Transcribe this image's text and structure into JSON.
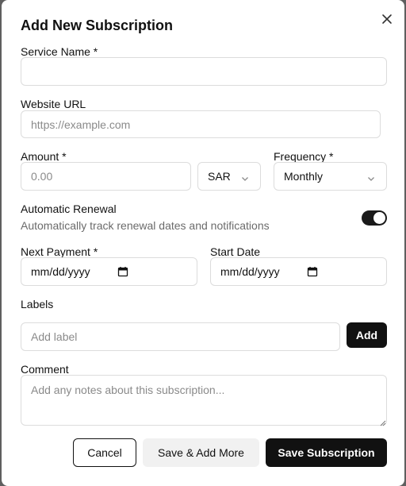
{
  "dialog": {
    "title": "Add New Subscription"
  },
  "form": {
    "service_name": {
      "label": "Service Name *",
      "value": "",
      "placeholder": ""
    },
    "website_url": {
      "label": "Website URL",
      "value": "",
      "placeholder": "https://example.com"
    },
    "amount": {
      "label": "Amount *",
      "value": "",
      "placeholder": "0.00"
    },
    "currency": {
      "value": "SAR"
    },
    "frequency": {
      "label": "Frequency *",
      "value": "Monthly"
    },
    "automatic_renewal": {
      "label": "Automatic Renewal",
      "description": "Automatically track renewal dates and notifications",
      "enabled": true
    },
    "next_payment": {
      "label": "Next Payment *",
      "placeholder": "mm/dd/yyyy"
    },
    "start_date": {
      "label": "Start Date",
      "placeholder": "mm/dd/yyyy"
    },
    "labels": {
      "label": "Labels",
      "placeholder": "Add label",
      "add_button": "Add"
    },
    "comment": {
      "label": "Comment",
      "placeholder": "Add any notes about this subscription..."
    }
  },
  "actions": {
    "cancel": "Cancel",
    "save_add_more": "Save & Add More",
    "save": "Save Subscription"
  },
  "colors": {
    "primary": "#111111",
    "border": "#dcdcdc",
    "muted_text": "#6b6b6b",
    "overlay": "#5f5f5f"
  }
}
